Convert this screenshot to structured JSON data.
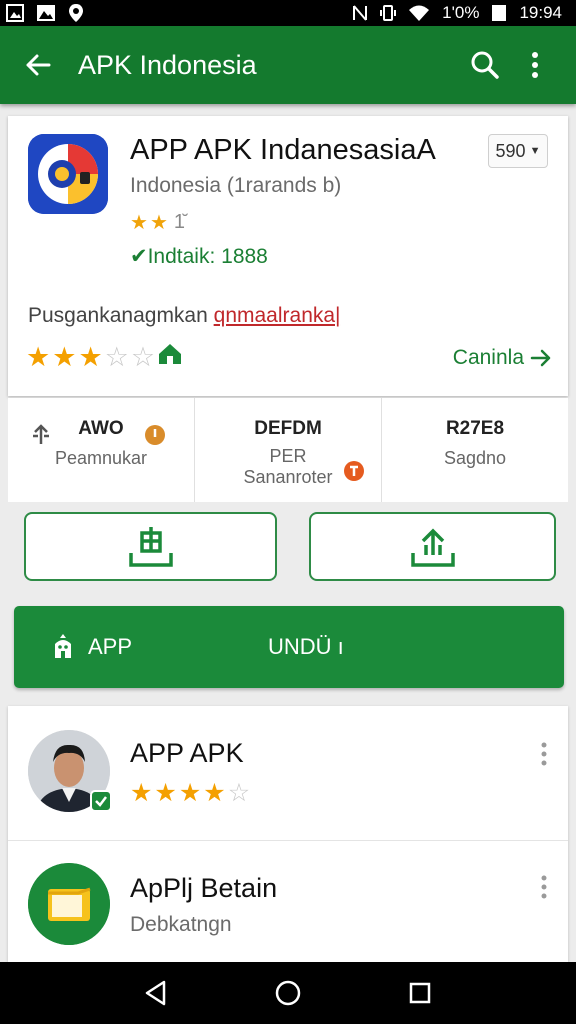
{
  "status_bar": {
    "battery": "1'0%",
    "time": "19:94"
  },
  "app_bar": {
    "title": "APK Indonesia"
  },
  "app": {
    "name": "APP APK IndanesasiaA",
    "version": "590",
    "developer": "Indonesia (1rarands b)",
    "small_rating_text": "1̆",
    "verified": "✔Indtaik: 1888",
    "description_plain": "Pusgankanagmkan ",
    "description_link": "qnmaalranka|",
    "rating_filled": 3,
    "rating_total": 5,
    "continue_label": "Caninla"
  },
  "stats": [
    {
      "value": "AWO",
      "label": "Peamnukar"
    },
    {
      "value": "DEFDM",
      "sub": "PER",
      "label": "Sananroter"
    },
    {
      "value": "R27E8",
      "label": "Sagdno"
    }
  ],
  "install": {
    "left_label": "APP",
    "right_label": "UNDÜ ı"
  },
  "list": [
    {
      "title": "APP APK",
      "rating_filled": 4,
      "rating_total": 5
    },
    {
      "title": "ApPlj Betain",
      "subtitle": "Debkatngn"
    }
  ],
  "colors": {
    "primary": "#147a2e",
    "accent": "#1b8a3a",
    "star": "#f4a000",
    "link_red": "#c0282b"
  }
}
